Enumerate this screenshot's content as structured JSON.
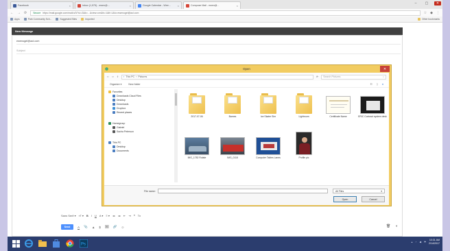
{
  "browser": {
    "tabs": [
      {
        "label": "Facebook",
        "color": "#3b5998",
        "active": false
      },
      {
        "label": "Inbox (1,575) - ewen@...",
        "color": "#d44638",
        "active": false
      },
      {
        "label": "Google Calendar - Wee...",
        "color": "#4285f4",
        "active": false
      },
      {
        "label": "Compose Mail - ewen@...",
        "color": "#d44638",
        "active": true
      }
    ],
    "tab_close": "×",
    "window_controls": [
      "–",
      "▢",
      "✕"
    ],
    "nav": {
      "back": "←",
      "forward": "→",
      "reload": "⟳"
    },
    "address": {
      "secure_label": "Secure",
      "url": "https://mail.google.com/mail/u/0/?ui=2&ik=...&view=cm&fs=1&tf=1&to=ewenogel@aol.com"
    },
    "bookmarks": [
      {
        "label": "Apps"
      },
      {
        "label": "Park Community Sch..."
      },
      {
        "label": "Suggested Sites"
      },
      {
        "label": "Imported"
      }
    ],
    "other_bookmarks": "Other bookmarks"
  },
  "compose": {
    "title": "New Message",
    "to": "ewenogel@aol.com",
    "subject_placeholder": "Subject",
    "format_tools": [
      "Sans Serif ▾",
      "ᴛT ▾",
      "B",
      "I",
      "U",
      "A ▾",
      "≡ ▾",
      "≔",
      "≔",
      "⇤",
      "⇥",
      "❝",
      "Tx"
    ],
    "send_label": "Send",
    "bottom_tools": [
      "A",
      "📎",
      "▲",
      "$",
      "🖼",
      "🔗",
      "☺"
    ],
    "trash_icon": "🗑",
    "more_icon": "▾"
  },
  "dialog": {
    "title": "Open",
    "close": "✕",
    "path": [
      "This PC",
      "Pictures"
    ],
    "search_placeholder": "Search Pictures",
    "organize": "Organize ▾",
    "new_folder": "New folder",
    "sidebar": [
      {
        "label": "Favorites",
        "indent": 0,
        "color": "#f0c040"
      },
      {
        "label": "Downloads Cloud Files",
        "indent": 1,
        "color": "#4a7dc0"
      },
      {
        "label": "Desktop",
        "indent": 1,
        "color": "#4a7dc0"
      },
      {
        "label": "Downloads",
        "indent": 1,
        "color": "#4a7dc0"
      },
      {
        "label": "Dropbox",
        "indent": 1,
        "color": "#3d8fd6"
      },
      {
        "label": "Recent places",
        "indent": 1,
        "color": "#4a7dc0"
      },
      {
        "label": "Homegroup",
        "indent": 0,
        "color": "#2c8c5c"
      },
      {
        "label": "Gabriel",
        "indent": 1,
        "color": "#555555"
      },
      {
        "label": "Sacha Peterson",
        "indent": 1,
        "color": "#555555"
      },
      {
        "label": "This PC",
        "indent": 0,
        "color": "#4a7dc0"
      },
      {
        "label": "Desktop",
        "indent": 1,
        "color": "#4a7dc0"
      },
      {
        "label": "Documents",
        "indent": 1,
        "color": "#4a7dc0"
      }
    ],
    "files": [
      {
        "name": "2017-07-06",
        "kind": "folder"
      },
      {
        "name": "Barnes",
        "kind": "folder"
      },
      {
        "name": "Ice Skater Sim",
        "kind": "folder"
      },
      {
        "name": "Lightroom",
        "kind": "folder"
      },
      {
        "name": "Certificate Name",
        "kind": "doc"
      },
      {
        "name": "ERIC Contract system desk",
        "kind": "screen"
      },
      {
        "name": "IMG_1782 Rotate",
        "kind": "photo-car"
      },
      {
        "name": "IMG_0118",
        "kind": "photo-red"
      },
      {
        "name": "Computer Tables Lanes",
        "kind": "photo-blue"
      },
      {
        "name": "Profile pic",
        "kind": "photo-person"
      }
    ],
    "filename_label": "File name:",
    "filename_value": "",
    "filetype": "All Files",
    "open_label": "Open",
    "cancel_label": "Cancel"
  },
  "taskbar": {
    "apps": [
      {
        "name": "start",
        "color": "#ffffff"
      },
      {
        "name": "internet-explorer",
        "color": "#3b9ce8"
      },
      {
        "name": "file-explorer",
        "color": "#f2c14e"
      },
      {
        "name": "windows-store",
        "color": "#4f8be0"
      },
      {
        "name": "chrome",
        "color": "#e94235"
      },
      {
        "name": "photoshop",
        "color": "#0b3a5c"
      }
    ],
    "time": "10:31 AM",
    "date": "2/14/2017"
  }
}
